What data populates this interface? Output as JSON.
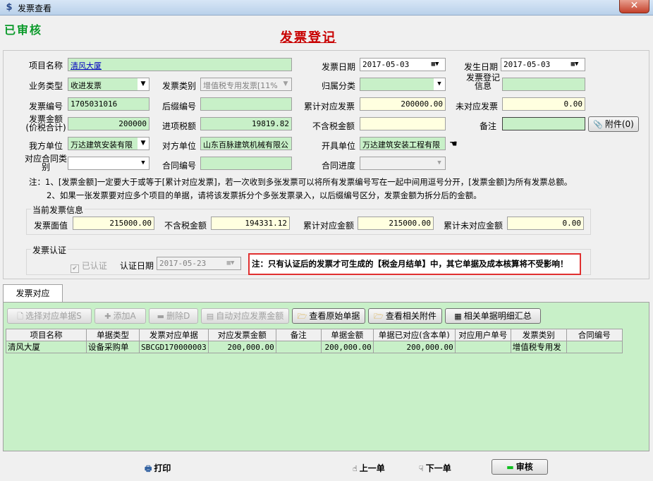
{
  "window": {
    "title": "发票查看",
    "close_glyph": "✕"
  },
  "status_stamp": "已审核",
  "form_title": "发票登记",
  "fields": {
    "project_name_label": "项目名称",
    "project_name": "清风大厦",
    "invoice_date_label": "发票日期",
    "invoice_date": "2017-05-03",
    "occur_date_label": "发生日期",
    "occur_date": "2017-05-03",
    "business_type_label": "业务类型",
    "business_type": "收进发票",
    "invoice_category_label": "发票类别",
    "invoice_category": "增值税专用发票[11%",
    "belong_category_label": "归属分类",
    "belong_category": "",
    "register_info_label": "发票登记信息",
    "register_info": "",
    "invoice_no_label": "发票编号",
    "invoice_no": "1705031016",
    "suffix_no_label": "后缀编号",
    "suffix_no": "",
    "cumulative_label": "累计对应发票",
    "cumulative": "200000.00",
    "unmatched_label": "未对应发票",
    "unmatched": "0.00",
    "amount_label": "发票金额(价税合计)",
    "amount": "200000",
    "input_tax_label": "进项税额",
    "input_tax": "19819.82",
    "excl_tax_label": "不含税金额",
    "excl_tax": "",
    "remark_label": "备注",
    "remark": "",
    "attachment_button": "附件(0)",
    "our_unit_label": "我方单位",
    "our_unit": "万达建筑安装有限",
    "counter_unit_label": "对方单位",
    "counter_unit": "山东百脉建筑机械有限公",
    "issuer_unit_label": "开具单位",
    "issuer_unit": "万达建筑安装工程有限",
    "contract_type_label": "对应合同类别",
    "contract_type": "",
    "contract_no_label": "合同编号",
    "contract_no": "",
    "contract_progress_label": "合同进度",
    "contract_progress": ""
  },
  "notes": [
    "注：1、[发票金额]一定要大于或等于[累计对应发票]，若一次收到多张发票可以将所有发票编号写在一起中间用逗号分开，[发票金额]为所有发票总额。",
    "2、如果一张发票要对应多个项目的单据，请将该发票拆分个多张发票录入，以后缀编号区分，发票金额为拆分后的金额。"
  ],
  "current_info": {
    "title": "当前发票信息",
    "face_value_label": "发票面值",
    "face_value": "215000.00",
    "excl_tax_label": "不含税金额",
    "excl_tax": "194331.12",
    "cumulative_label": "累计对应金额",
    "cumulative": "215000.00",
    "unmatched_label": "累计未对应金额",
    "unmatched": "0.00"
  },
  "certification": {
    "title": "发票认证",
    "certified_label": "已认证",
    "cert_date_label": "认证日期",
    "cert_date": "2017-05-23",
    "warning": "注：只有认证后的发票才可生成的【税金月结单】中，其它单据及成本核算将不受影响！"
  },
  "tabs": [
    {
      "label": "发票对应"
    }
  ],
  "toolbar": {
    "select_docs": "选择对应单据S",
    "add": "添加A",
    "delete": "删除D",
    "auto_match": "自动对应发票金额",
    "view_original": "查看原始单据",
    "view_attachments": "查看相关附件",
    "doc_summary": "相关单据明细汇总"
  },
  "table": {
    "headers": [
      "项目名称",
      "单据类型",
      "发票对应单据",
      "对应发票金额",
      "备注",
      "单据金额",
      "单据已对应(含本单)",
      "对应用户单号",
      "发票类别",
      "合同编号"
    ],
    "rows": [
      [
        "清风大厦",
        "设备采购单",
        "SBCGD170000003",
        "200,000.00",
        "",
        "200,000.00",
        "200,000.00",
        "",
        "增值税专用发",
        ""
      ]
    ]
  },
  "bottom": {
    "print": "打印",
    "prev": "上一单",
    "next": "下一单",
    "audit": "审核"
  },
  "colors": {
    "field_green": "#c8f0c8",
    "field_yellow": "#ffffe0",
    "title_red": "#c80000",
    "stamp_green": "#0a9a2a",
    "warning_border": "#e03030"
  }
}
